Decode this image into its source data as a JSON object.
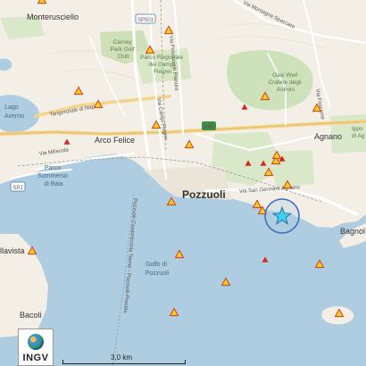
{
  "map": {
    "place_labels": [
      {
        "id": "monterusciello",
        "text": "Monterusciello"
      },
      {
        "id": "pozzuoli",
        "text": "Pozzuoli"
      },
      {
        "id": "arco-felice",
        "text": "Arco Felice"
      },
      {
        "id": "agnano",
        "text": "Agnano"
      },
      {
        "id": "bacoli",
        "text": "Bacoli"
      },
      {
        "id": "bagnoli",
        "text": "Bagnol"
      },
      {
        "id": "vista",
        "text": "llavista"
      }
    ],
    "water_labels": [
      {
        "id": "lago-averno",
        "lines": [
          "Lago",
          "Averno"
        ]
      },
      {
        "id": "golfo-pozzuoli",
        "lines": [
          "Golfo di",
          "Pozzuoli"
        ]
      }
    ],
    "green_labels": [
      {
        "id": "carney-park",
        "lines": [
          "Carney",
          "Park Golf",
          "Club"
        ]
      },
      {
        "id": "campi-flegrei-park",
        "lines": [
          "Parco Regionale",
          "dei Campi",
          "Flegrei"
        ]
      },
      {
        "id": "astroni",
        "lines": [
          "Oasi Wwf",
          "Cratere degli",
          "Astroni"
        ]
      },
      {
        "id": "parco-sommerso",
        "lines": [
          "Parco",
          "Sommerso",
          "di Baia"
        ]
      },
      {
        "id": "ippodromo",
        "lines": [
          "Ippo",
          "di Ag"
        ]
      }
    ],
    "road_labels": [
      {
        "id": "via-miliscola",
        "text": "Via Miliscola"
      },
      {
        "id": "via-campi-flegrei",
        "text": "Via Campi Flegrei"
      },
      {
        "id": "tangenziale",
        "text": "Tangenziale di Napoli"
      },
      {
        "id": "via-san-gennaro",
        "text": "Via San Gennaro Agnano"
      },
      {
        "id": "via-provinciale",
        "text": "Via Provinciale Pianura"
      },
      {
        "id": "ferry-route",
        "text": "Pozzuoli-Casamicciola Terme - Pozzuoli-Procida"
      },
      {
        "id": "via-fascione",
        "text": "Via Fascione"
      },
      {
        "id": "via-montagna-spaccata",
        "text": "Via Montagna Spaccata"
      }
    ],
    "shields": [
      {
        "id": "sp501",
        "text": "SP501"
      },
      {
        "id": "a56",
        "text": "A56"
      },
      {
        "id": "sp2",
        "text": "SP2"
      }
    ],
    "markers": {
      "event_symbol": "star",
      "event_color": "#3fd0f0",
      "triangle_fill": "#ffd21f",
      "triangle_stroke": "#d23a1e",
      "solid_triangle_color": "#d8261e"
    }
  },
  "logo": {
    "text": "INGV",
    "icon": "globe-icon"
  },
  "scale": {
    "text": "3,0 km"
  }
}
